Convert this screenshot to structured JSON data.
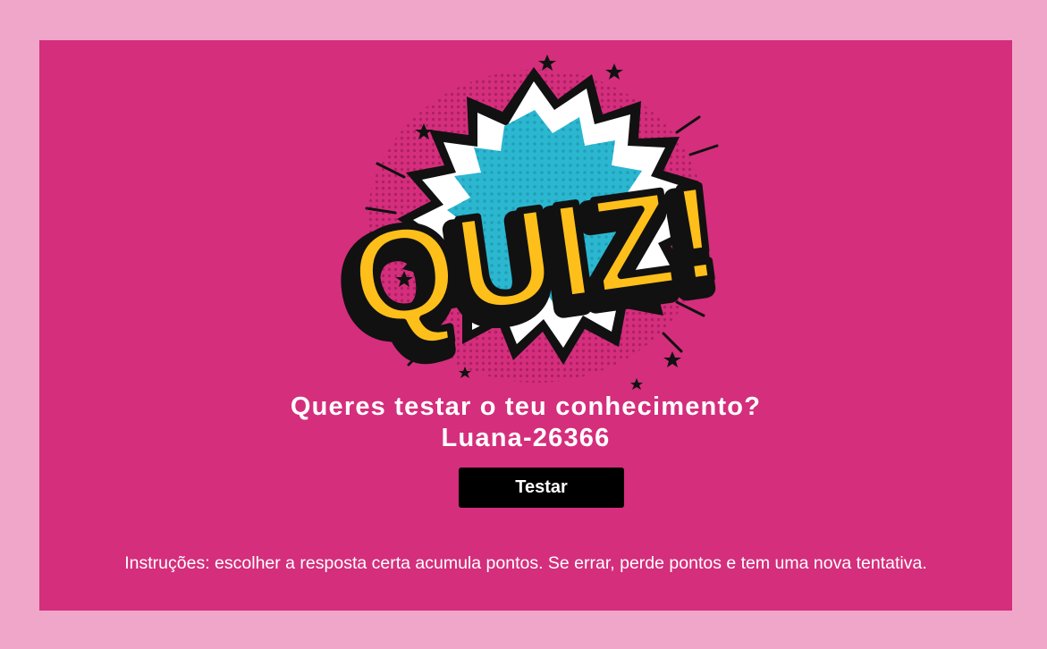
{
  "logo": {
    "text": "QUIZ!",
    "icon": "quiz-comic-burst-logo",
    "colors": {
      "burst_outer": "#ffffff",
      "burst_inner": "#2bb7d0",
      "letters": "#ffbf1a",
      "outline": "#111111"
    }
  },
  "heading": {
    "line1": "Queres testar o teu conhecimento?",
    "line2": "Luana-26366"
  },
  "start_button": {
    "label": "Testar"
  },
  "instructions": "Instruções: escolher a resposta certa acumula pontos. Se errar, perde pontos e tem uma nova tentativa.",
  "colors": {
    "page_background": "#f0a6c9",
    "card_background": "#d42e7c",
    "button_background": "#000000",
    "text": "#ffffff"
  }
}
